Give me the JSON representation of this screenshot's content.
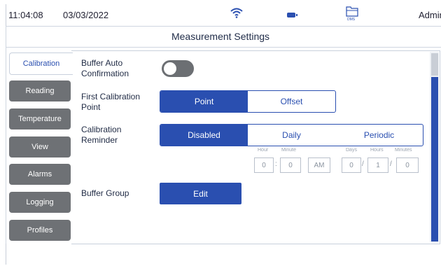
{
  "status": {
    "time": "11:04:08",
    "date": "03/03/2022",
    "user": "Admin",
    "folder_label": "DMS"
  },
  "icons": {
    "wifi": "wifi-icon",
    "battery": "battery-icon",
    "folder": "folder-icon"
  },
  "page": {
    "title": "Measurement Settings"
  },
  "tabs": [
    {
      "label": "Calibration",
      "active": true
    },
    {
      "label": "Reading"
    },
    {
      "label": "Temperature"
    },
    {
      "label": "View"
    },
    {
      "label": "Alarms"
    },
    {
      "label": "Logging"
    },
    {
      "label": "Profiles"
    }
  ],
  "settings": {
    "buffer_auto": {
      "label": "Buffer Auto Confirmation",
      "enabled": false
    },
    "first_cal": {
      "label": "First Calibration Point",
      "options": [
        "Point",
        "Offset"
      ],
      "selected": "Point"
    },
    "reminder": {
      "label": "Calibration Reminder",
      "options": [
        "Disabled",
        "Daily",
        "Periodic"
      ],
      "selected": "Disabled",
      "hour_label": "Hour",
      "minute_label": "Minute",
      "days_label": "Days",
      "hours_label": "Hours",
      "minutes_label": "Minutes",
      "hour_value": "0",
      "minute_value": "0",
      "ampm_value": "AM",
      "days_value": "0",
      "hours_value": "1",
      "minutes_value": "0"
    },
    "buffer_group": {
      "label": "Buffer Group",
      "button": "Edit"
    }
  },
  "colors": {
    "accent": "#2a4fb0",
    "tab_inactive": "#6e7175"
  }
}
